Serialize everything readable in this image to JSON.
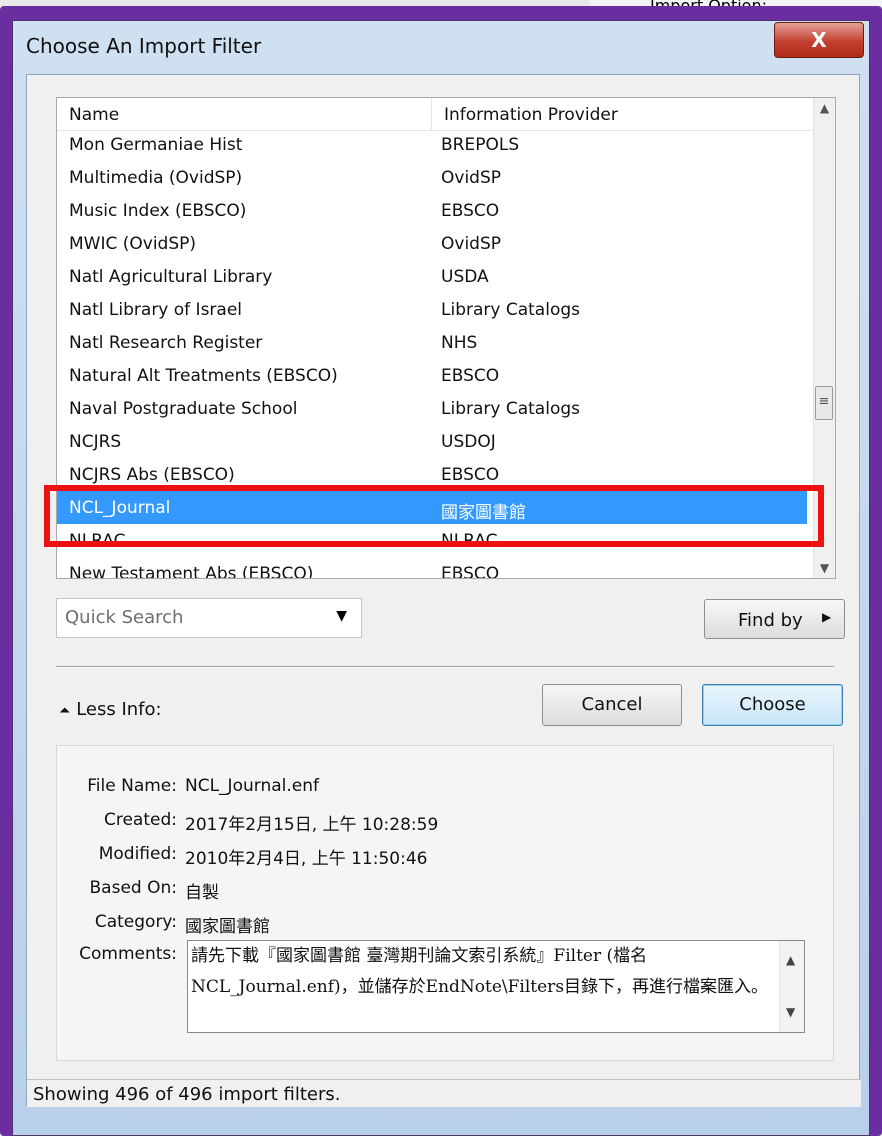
{
  "dialog": {
    "title": "Choose An Import Filter",
    "close_label": "X"
  },
  "background": {
    "import_option_label": "Import Option:"
  },
  "list": {
    "columns": [
      "Name",
      "Information Provider"
    ],
    "rows": [
      {
        "name": "Mon Germaniae Hist",
        "provider": "BREPOLS"
      },
      {
        "name": "Multimedia (OvidSP)",
        "provider": "OvidSP"
      },
      {
        "name": "Music Index (EBSCO)",
        "provider": "EBSCO"
      },
      {
        "name": "MWIC (OvidSP)",
        "provider": "OvidSP"
      },
      {
        "name": "Natl Agricultural Library",
        "provider": "USDA"
      },
      {
        "name": "Natl Library of Israel",
        "provider": "Library Catalogs"
      },
      {
        "name": "Natl Research Register",
        "provider": "NHS"
      },
      {
        "name": "Natural Alt Treatments (EBSCO)",
        "provider": "EBSCO"
      },
      {
        "name": "Naval Postgraduate School",
        "provider": "Library Catalogs"
      },
      {
        "name": "NCJRS",
        "provider": "USDOJ"
      },
      {
        "name": "NCJRS Abs (EBSCO)",
        "provider": "EBSCO"
      },
      {
        "name": "NCL_Journal",
        "provider": "國家圖書館",
        "selected": true
      },
      {
        "name": "NLRAC",
        "provider": "NLRAC"
      },
      {
        "name": "New Testament Abs (EBSCO)",
        "provider": "EBSCO"
      }
    ]
  },
  "search": {
    "placeholder": "Quick Search",
    "find_by_label": "Find by"
  },
  "less_info_label": "Less Info:",
  "buttons": {
    "cancel": "Cancel",
    "choose": "Choose"
  },
  "info": {
    "file_name_label": "File Name:",
    "file_name": "NCL_Journal.enf",
    "created_label": "Created:",
    "created": "2017年2月15日, 上午 10:28:59",
    "modified_label": "Modified:",
    "modified": "2010年2月4日, 上午 11:50:46",
    "based_on_label": "Based On:",
    "based_on": "自製",
    "category_label": "Category:",
    "category": "國家圖書館",
    "comments_label": "Comments:",
    "comments": "請先下載『國家圖書館 臺灣期刊論文索引系統』Filter (檔名NCL_Journal.enf)，並儲存於EndNote\\Filters目錄下，再進行檔案匯入。"
  },
  "status_text": "Showing 496 of 496 import filters.",
  "colors": {
    "frame": "#6a2ea0",
    "selection": "#3399ff",
    "highlight_box": "#ee1111"
  }
}
